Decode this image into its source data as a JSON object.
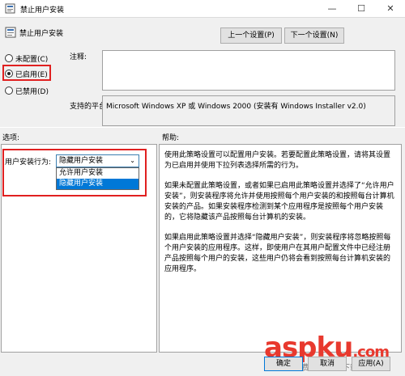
{
  "window": {
    "title": "禁止用户安装",
    "minimize": "—",
    "maximize": "☐",
    "close": "✕"
  },
  "header": {
    "title": "禁止用户安装",
    "prev_button": "上一个设置(P)",
    "next_button": "下一个设置(N)"
  },
  "state": {
    "not_configured": "未配置(C)",
    "enabled": "已启用(E)",
    "disabled": "已禁用(D)",
    "selected": "enabled"
  },
  "comment": {
    "label": "注释:",
    "value": ""
  },
  "platform": {
    "label": "支持的平台:",
    "value": "Microsoft Windows XP 或 Windows 2000 (安装有 Windows Installer v2.0)"
  },
  "options": {
    "label": "选项:",
    "behavior_label": "用户安装行为:",
    "selected_value": "隐藏用户安装",
    "dropdown_options": [
      "允许用户安装",
      "隐藏用户安装"
    ]
  },
  "help": {
    "label": "帮助:",
    "paragraphs": [
      "使用此策略设置可以配置用户安装。若要配置此策略设置，请将其设置为已启用并使用下拉列表选择所需的行为。",
      "如果未配置此策略设置，或者如果已启用此策略设置并选择了“允许用户安装”，则安装程序将允许并使用按照每个用户安装的和按照每台计算机安装的产品。如果安装程序检测到某个应用程序是按照每个用户安装的，它将隐藏该产品按照每台计算机的安装。",
      "如果启用此策略设置并选择“隐藏用户安装”，则安装程序将忽略按照每个用户安装的应用程序。这样，即使用户在其用户配置文件中已经注册产品按照每个用户的安装，这些用户仍将会看到按照每台计算机安装的应用程序。"
    ]
  },
  "footer": {
    "ok": "确定",
    "cancel": "取消",
    "apply": "应用(A)"
  },
  "watermark": {
    "text": "aspku",
    "suffix": ".com",
    "sub": "免费网站源码下载站"
  }
}
